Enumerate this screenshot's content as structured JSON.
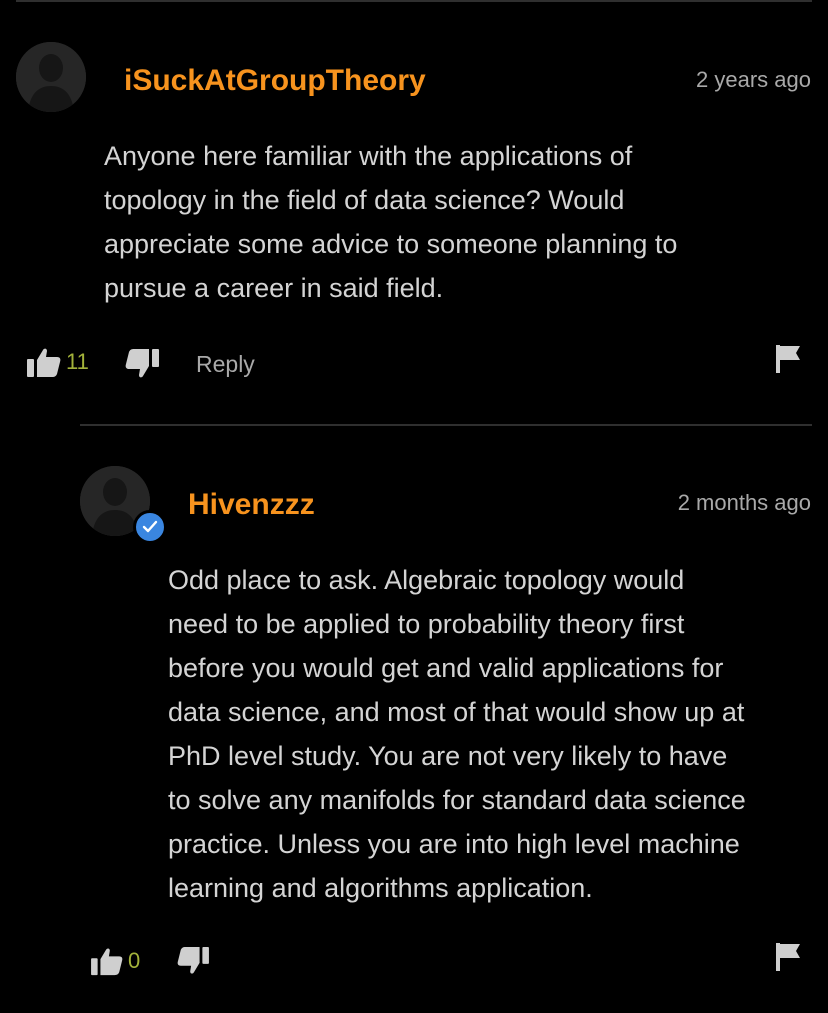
{
  "comments": [
    {
      "username": "iSuckAtGroupTheory",
      "timestamp": "2 years ago",
      "text_lines": [
        "Anyone here familiar with the applications of",
        "topology in the field of data science? Would",
        "appreciate some advice to someone planning to",
        "pursue a career in said field."
      ],
      "likes": "11",
      "reply_label": "Reply",
      "verified": false
    },
    {
      "username": "Hivenzzz",
      "timestamp": "2 months ago",
      "text_lines": [
        "Odd place to ask. Algebraic topology would",
        "need to be applied to probability theory first",
        "before you would get and valid applications for",
        "data science, and most of that would show up at",
        "PhD level study. You are not very likely to have",
        "to solve any manifolds for standard data science",
        "practice. Unless you are into high level machine",
        "learning and algorithms application."
      ],
      "likes": "0",
      "verified": true
    }
  ],
  "colors": {
    "background": "#000000",
    "username": "#f7931e",
    "like_count": "#a3b23a",
    "verified_badge": "#3a86e0",
    "divider": "#2f2f2f"
  },
  "icons": [
    "avatar-placeholder",
    "verified-check-icon",
    "thumbs-up-icon",
    "thumbs-down-icon",
    "flag-icon"
  ]
}
